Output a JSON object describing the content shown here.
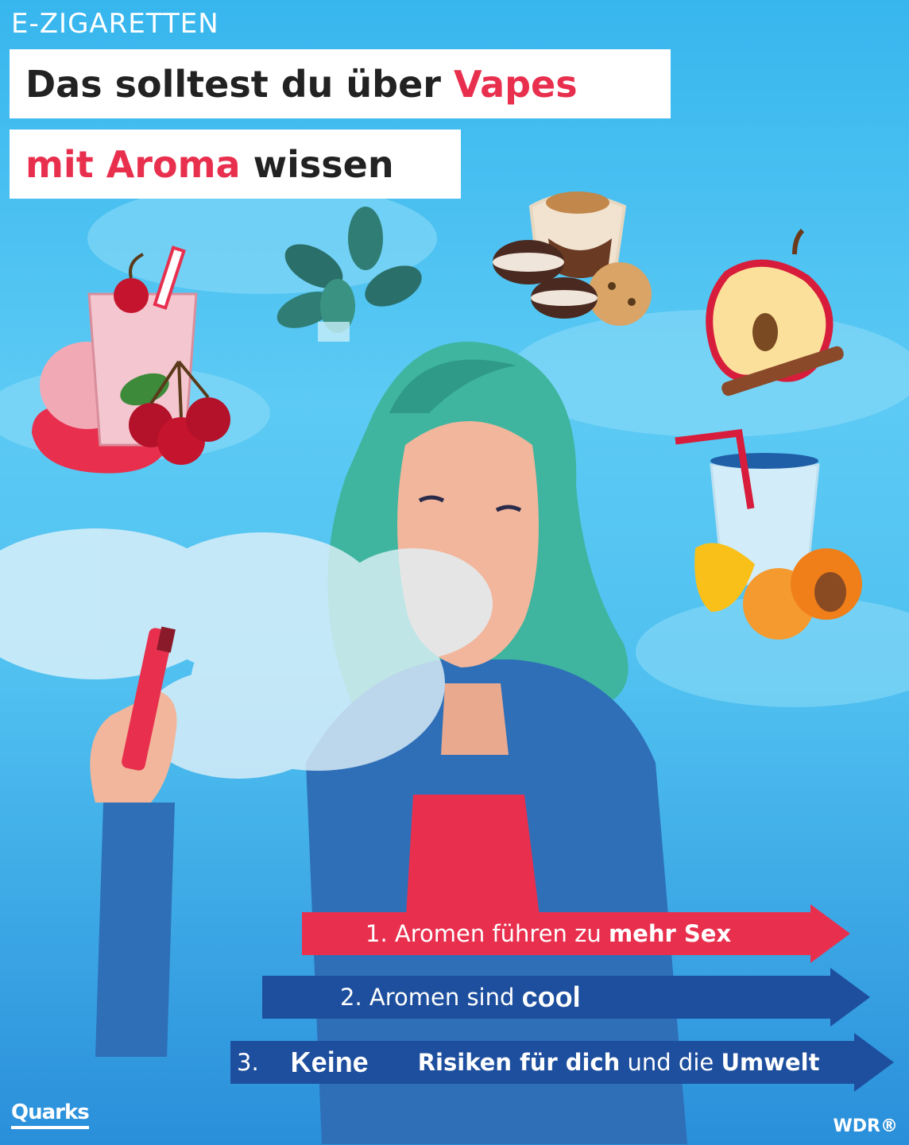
{
  "header": {
    "kicker": "E-ZIGARETTEN",
    "line1_a": "Das solltest du über ",
    "line1_b": "Vapes",
    "line2_a": "mit Aroma",
    "line2_b": " wissen"
  },
  "colors": {
    "accent_red": "#e8304e",
    "arrow_blue": "#1e4f9e",
    "hair_teal": "#3fb5a0"
  },
  "icons": [
    "cherry-milkshake-icon",
    "mint-leaves-icon",
    "cookies-dessert-icon",
    "apple-cinnamon-icon",
    "lemonade-apricot-icon",
    "vape-device-icon"
  ],
  "points": [
    {
      "prefix": "1. Aromen führen zu ",
      "bold": "mehr Sex"
    },
    {
      "prefix": "2. Aromen sind ",
      "bold": "cool"
    },
    {
      "prefix": "3.",
      "bold": "Keine",
      "mid": "Risiken für dich",
      "tail": " und die ",
      "end": "Umwelt"
    }
  ],
  "footer": {
    "left_logo": "Quarks",
    "right_logo": "WDR®"
  }
}
